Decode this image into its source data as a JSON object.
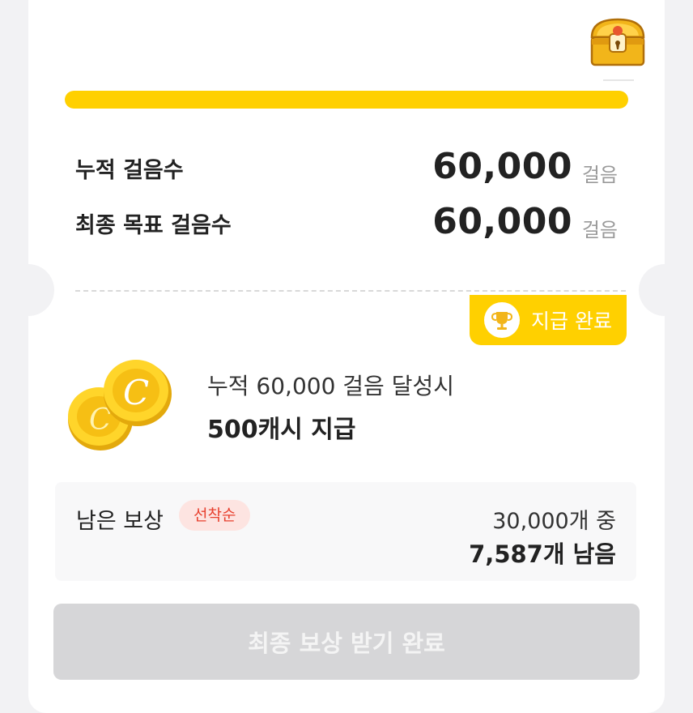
{
  "progress": {
    "value": 1.0,
    "color": "#ffd000"
  },
  "stats": {
    "cumulative": {
      "label": "누적 걸음수",
      "value": "60,000",
      "unit": "걸음"
    },
    "goal": {
      "label": "최종 목표 걸음수",
      "value": "60,000",
      "unit": "걸음"
    }
  },
  "badge": {
    "text": "지급 완료",
    "icon": "trophy-icon"
  },
  "reward": {
    "condition": "누적 60,000 걸음 달성시",
    "amount": "500캐시 지급",
    "icon": "coins-icon"
  },
  "remaining": {
    "label": "남은 보상",
    "tag": "선착순",
    "total": "30,000개 중",
    "left": "7,587개 남음"
  },
  "final_button": {
    "label": "최종 보상 받기 완료"
  },
  "colors": {
    "accent": "#ffd000",
    "tag_text": "#e8402e",
    "disabled": "#d6d6d8"
  }
}
